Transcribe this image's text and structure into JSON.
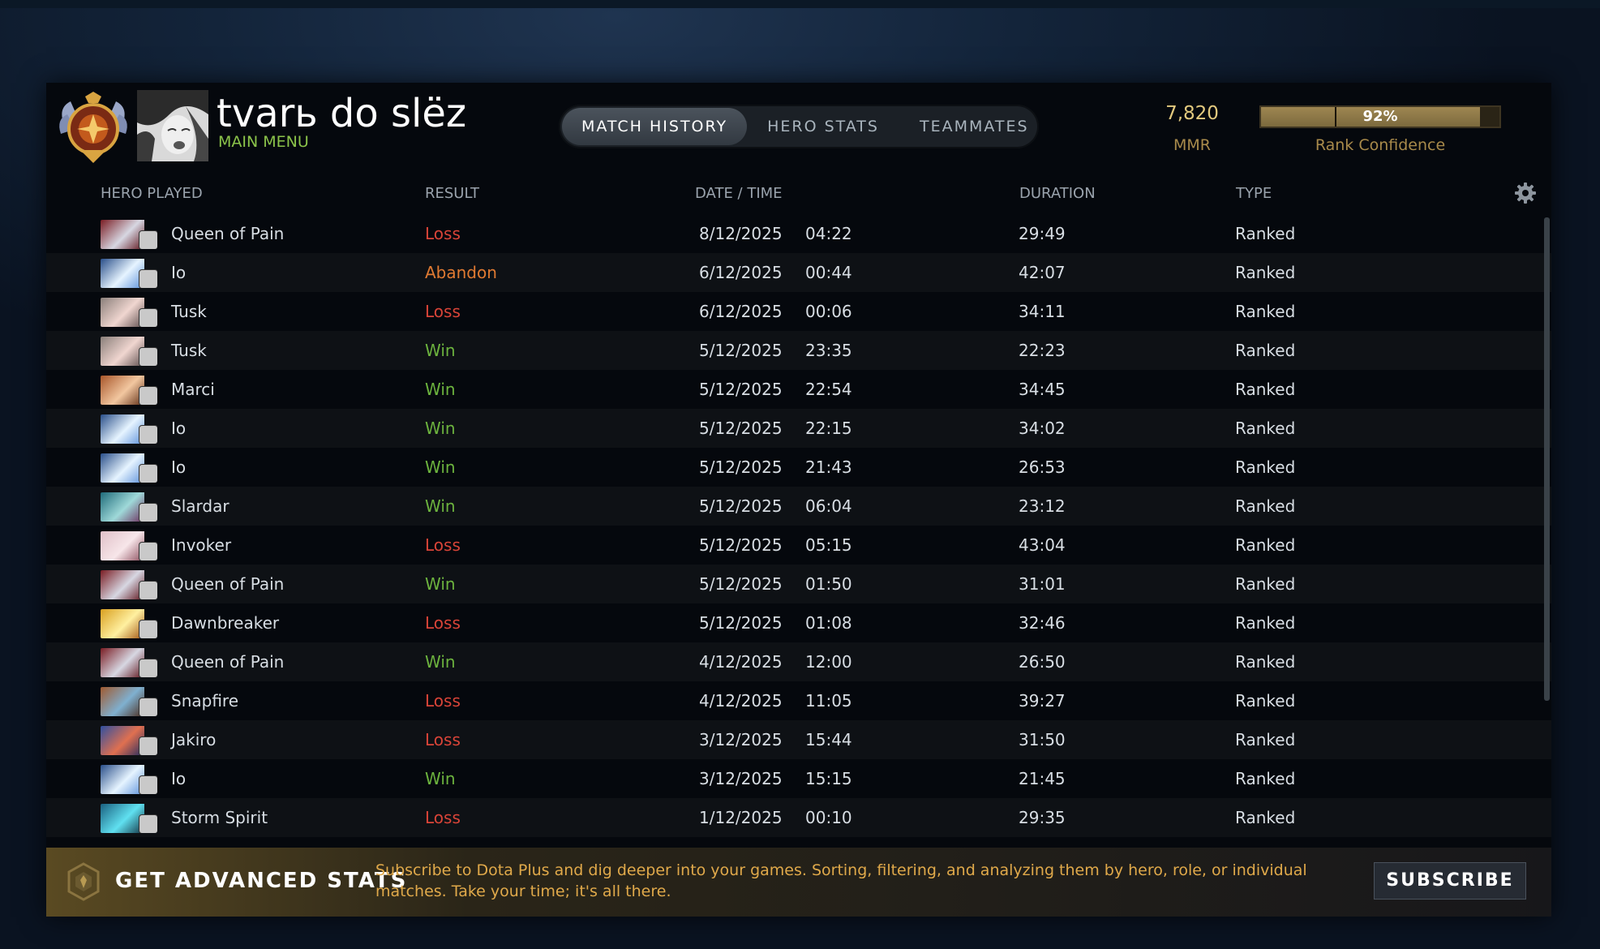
{
  "profile": {
    "player_name": "tvarь do slёz",
    "main_menu_label": "MAIN MENU"
  },
  "tabs": [
    {
      "label": "MATCH HISTORY",
      "active": true
    },
    {
      "label": "HERO STATS",
      "active": false
    },
    {
      "label": "TEAMMATES",
      "active": false
    }
  ],
  "rank": {
    "mmr_value": "7,820",
    "mmr_label": "MMR",
    "confidence_percent": "92%",
    "confidence_fraction": 0.92,
    "confidence_label": "Rank Confidence"
  },
  "table": {
    "headers": {
      "hero": "HERO PLAYED",
      "result": "RESULT",
      "datetime": "DATE / TIME",
      "duration": "DURATION",
      "type": "TYPE"
    },
    "rows": [
      {
        "hero": "Queen of Pain",
        "result": "Loss",
        "date": "8/12/2025",
        "time": "04:22",
        "duration": "29:49",
        "type": "Ranked"
      },
      {
        "hero": "Io",
        "result": "Abandon",
        "date": "6/12/2025",
        "time": "00:44",
        "duration": "42:07",
        "type": "Ranked"
      },
      {
        "hero": "Tusk",
        "result": "Loss",
        "date": "6/12/2025",
        "time": "00:06",
        "duration": "34:11",
        "type": "Ranked"
      },
      {
        "hero": "Tusk",
        "result": "Win",
        "date": "5/12/2025",
        "time": "23:35",
        "duration": "22:23",
        "type": "Ranked"
      },
      {
        "hero": "Marci",
        "result": "Win",
        "date": "5/12/2025",
        "time": "22:54",
        "duration": "34:45",
        "type": "Ranked"
      },
      {
        "hero": "Io",
        "result": "Win",
        "date": "5/12/2025",
        "time": "22:15",
        "duration": "34:02",
        "type": "Ranked"
      },
      {
        "hero": "Io",
        "result": "Win",
        "date": "5/12/2025",
        "time": "21:43",
        "duration": "26:53",
        "type": "Ranked"
      },
      {
        "hero": "Slardar",
        "result": "Win",
        "date": "5/12/2025",
        "time": "06:04",
        "duration": "23:12",
        "type": "Ranked"
      },
      {
        "hero": "Invoker",
        "result": "Loss",
        "date": "5/12/2025",
        "time": "05:15",
        "duration": "43:04",
        "type": "Ranked"
      },
      {
        "hero": "Queen of Pain",
        "result": "Win",
        "date": "5/12/2025",
        "time": "01:50",
        "duration": "31:01",
        "type": "Ranked"
      },
      {
        "hero": "Dawnbreaker",
        "result": "Loss",
        "date": "5/12/2025",
        "time": "01:08",
        "duration": "32:46",
        "type": "Ranked"
      },
      {
        "hero": "Queen of Pain",
        "result": "Win",
        "date": "4/12/2025",
        "time": "12:00",
        "duration": "26:50",
        "type": "Ranked"
      },
      {
        "hero": "Snapfire",
        "result": "Loss",
        "date": "4/12/2025",
        "time": "11:05",
        "duration": "39:27",
        "type": "Ranked"
      },
      {
        "hero": "Jakiro",
        "result": "Loss",
        "date": "3/12/2025",
        "time": "15:44",
        "duration": "31:50",
        "type": "Ranked"
      },
      {
        "hero": "Io",
        "result": "Win",
        "date": "3/12/2025",
        "time": "15:15",
        "duration": "21:45",
        "type": "Ranked"
      },
      {
        "hero": "Storm Spirit",
        "result": "Loss",
        "date": "1/12/2025",
        "time": "00:10",
        "duration": "29:35",
        "type": "Ranked"
      }
    ]
  },
  "promo": {
    "title": "GET ADVANCED STATS",
    "text": "Subscribe to Dota Plus and dig deeper into your games. Sorting, filtering, and analyzing them by hero, role, or individual matches. Take your time; it's all there.",
    "subscribe_label": "SUBSCRIBE"
  },
  "colors": {
    "win": "#6cb33e",
    "loss": "#d94438",
    "abandon": "#e07a32",
    "gold": "#e2c97e",
    "main_menu": "#8bc34a"
  },
  "icons": {
    "rank_medal": "rank-medal-icon",
    "settings": "gear-icon",
    "promo": "dota-plus-icon"
  }
}
